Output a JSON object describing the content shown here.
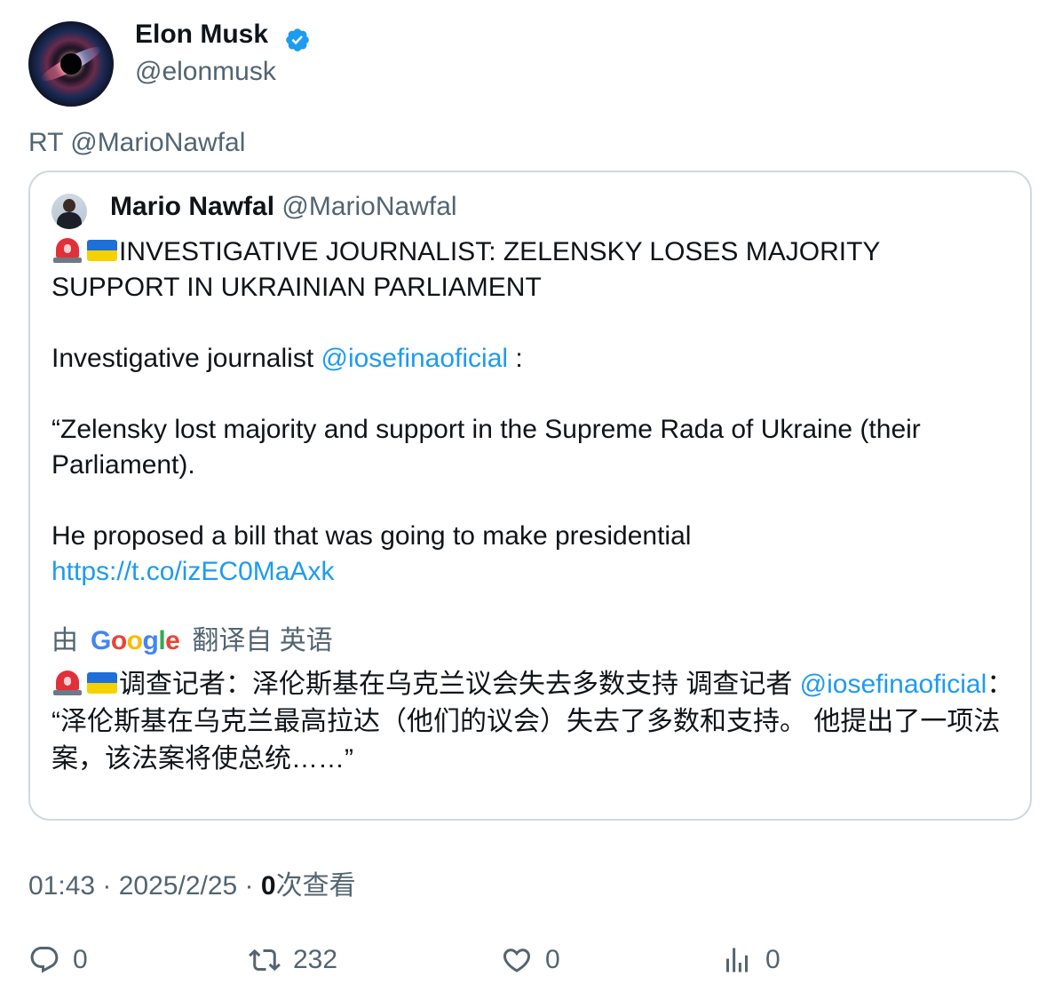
{
  "author": {
    "display_name": "Elon Musk",
    "handle": "@elonmusk",
    "verified_color": "#1d9bf0",
    "avatar_icon": "black-hole-avatar"
  },
  "retweet_line": "RT @MarioNawfal",
  "quote": {
    "display_name": "Mario Nawfal",
    "handle": "@MarioNawfal",
    "headline_emoji": [
      "siren-emoji",
      "ukraine-flag-emoji"
    ],
    "headline": "INVESTIGATIVE JOURNALIST: ZELENSKY LOSES MAJORITY SUPPORT IN UKRAINIAN PARLIAMENT",
    "para1_prefix": "Investigative journalist ",
    "para1_mention": "@iosefinaoficial",
    "para1_suffix": " :",
    "para2": "“Zelensky lost majority and support in the Supreme Rada of Ukraine (their Parliament).",
    "para3": "He proposed a bill that was going to make presidential",
    "link": "https://t.co/izEC0MaAxk"
  },
  "translation": {
    "prefix": "由",
    "google_letters": [
      "G",
      "o",
      "o",
      "g",
      "l",
      "e"
    ],
    "suffix": "翻译自 英语",
    "text_part1": "调查记者：泽伦斯基在乌克兰议会失去多数支持 调查记者 ",
    "mention": "@iosefinaoficial",
    "text_part2": "： “泽伦斯基在乌克兰最高拉达（他们的议会）失去了多数和支持。 他提出了一项法案，该法案将使总统……”"
  },
  "meta": {
    "time": "01:43",
    "separator": " · ",
    "date": "2025/2/25",
    "views_count": "0",
    "views_label": "次查看"
  },
  "actions": {
    "replies": "0",
    "retweets": "232",
    "likes": "0",
    "views": "0"
  },
  "colors": {
    "accent": "#1d9bf0",
    "muted": "#536471",
    "text": "#0f1419",
    "border": "#cfd9de"
  }
}
